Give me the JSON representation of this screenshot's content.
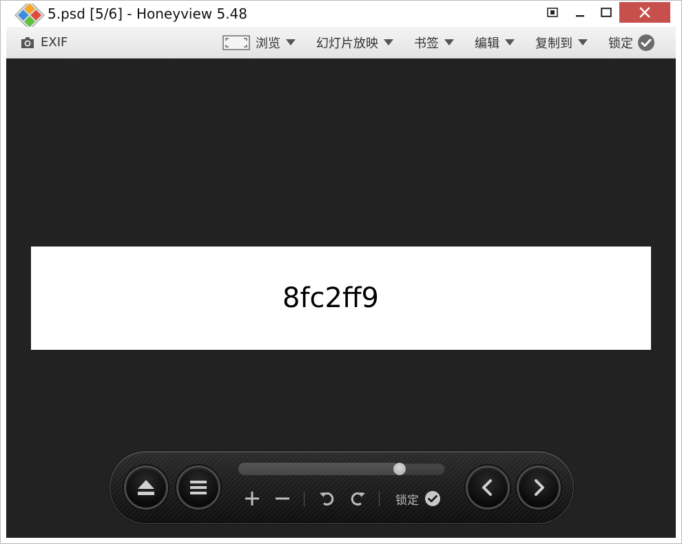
{
  "window": {
    "title": "5.psd [5/6] - Honeyview 5.48"
  },
  "toolbar": {
    "exif_label": "EXIF",
    "browse_label": "浏览",
    "slideshow_label": "幻灯片放映",
    "bookmark_label": "书签",
    "edit_label": "编辑",
    "copyto_label": "复制到",
    "lock_label": "锁定"
  },
  "viewer": {
    "image_text": "8fc2ff9",
    "background": "#222222"
  },
  "controls": {
    "lock_label": "锁定",
    "slider_position": 0.78
  },
  "colors": {
    "close_button": "#c7504d",
    "viewer_bg": "#222222"
  },
  "icons": [
    "app-logo-icon",
    "restore-icon",
    "minimize-icon",
    "maximize-icon",
    "close-icon",
    "camera-icon",
    "fit-screen-icon",
    "check-icon",
    "eject-icon",
    "list-icon",
    "zoom-in-icon",
    "zoom-out-icon",
    "rotate-left-icon",
    "rotate-right-icon",
    "chevron-left-icon",
    "chevron-right-icon"
  ]
}
